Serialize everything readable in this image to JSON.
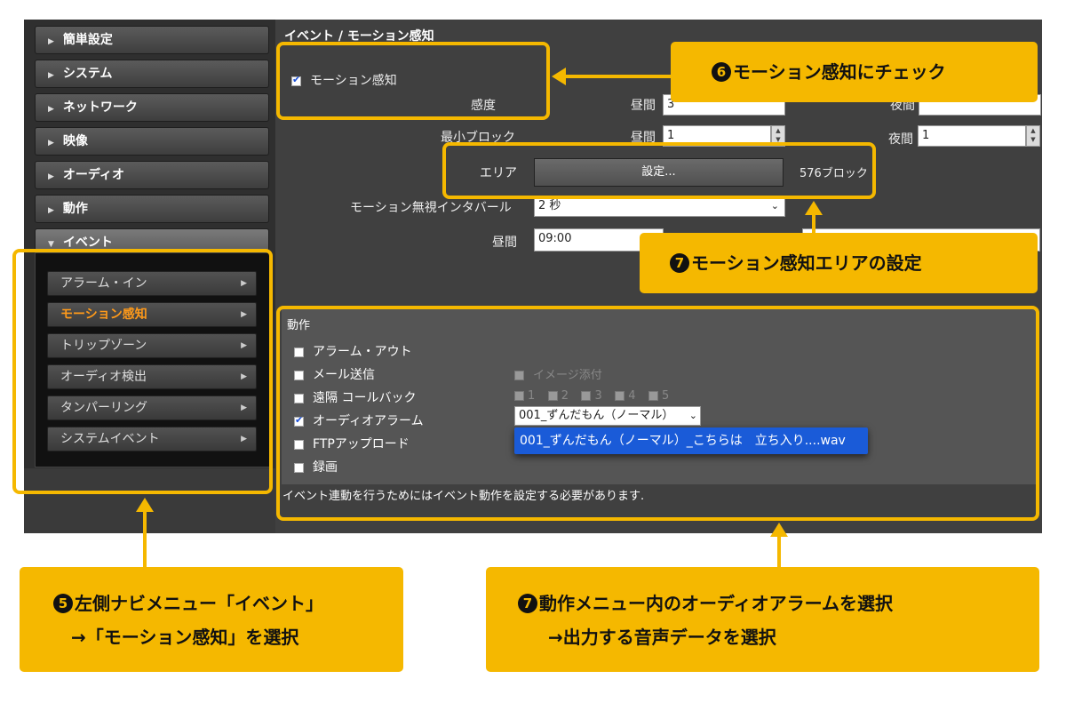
{
  "sidebar": {
    "items": [
      {
        "label": "簡単設定"
      },
      {
        "label": "システム"
      },
      {
        "label": "ネットワーク"
      },
      {
        "label": "映像"
      },
      {
        "label": "オーディオ"
      },
      {
        "label": "動作"
      },
      {
        "label": "イベント"
      }
    ],
    "submenu": [
      {
        "label": "アラーム・イン"
      },
      {
        "label": "モーション感知"
      },
      {
        "label": "トリップゾーン"
      },
      {
        "label": "オーディオ検出"
      },
      {
        "label": "タンパーリング"
      },
      {
        "label": "システムイベント"
      }
    ]
  },
  "content": {
    "title": "イベント / モーション感知",
    "motion_checkbox_label": "モーション感知",
    "sensitivity_label": "感度",
    "day_label": "昼間",
    "night_label": "夜間",
    "day_sensitivity_value": "3",
    "min_block_label": "最小ブロック",
    "min_block_day_value": "1",
    "min_block_night_value": "1",
    "area_label": "エリア",
    "area_button_label": "設定...",
    "area_blocks": "576ブロック",
    "ignore_interval_label": "モーション無視インタバール",
    "ignore_interval_value": "2 秒",
    "daytime_label": "昼間",
    "daytime_value": "09:00"
  },
  "actions": {
    "title": "動作",
    "alarm_out": "アラーム・アウト",
    "mail": "メール送信",
    "image_attach": "イメージ添付",
    "remote_callback": "遠隔 コールバック",
    "callback_numbers": [
      "1",
      "2",
      "3",
      "4",
      "5"
    ],
    "audio_alarm": "オーディオアラーム",
    "audio_select_value": "001_ずんだもん（ノーマル）",
    "audio_option": "001_ずんだもん（ノーマル）_こちらは　立ち入り....wav",
    "ftp_upload": "FTPアップロード",
    "recording": "録画",
    "footer_note": "イベント連動を行うためにはイベント動作を設定する必要があります."
  },
  "callouts": {
    "c6": "モーション感知にチェック",
    "c6_num": "6",
    "c7a": "モーション感知エリアの設定",
    "c7a_num": "7",
    "c5_line1": "左側ナビメニュー「イベント」",
    "c5_line2": "→「モーション感知」を選択",
    "c5_num": "5",
    "c7b_line1": "動作メニュー内のオーディオアラームを選択",
    "c7b_line2": "→出力する音声データを選択",
    "c7b_num": "7"
  },
  "colors": {
    "accent": "#f5b800",
    "selected_menu": "#ff9a1a",
    "dropdown_highlight": "#1a5bd8"
  }
}
